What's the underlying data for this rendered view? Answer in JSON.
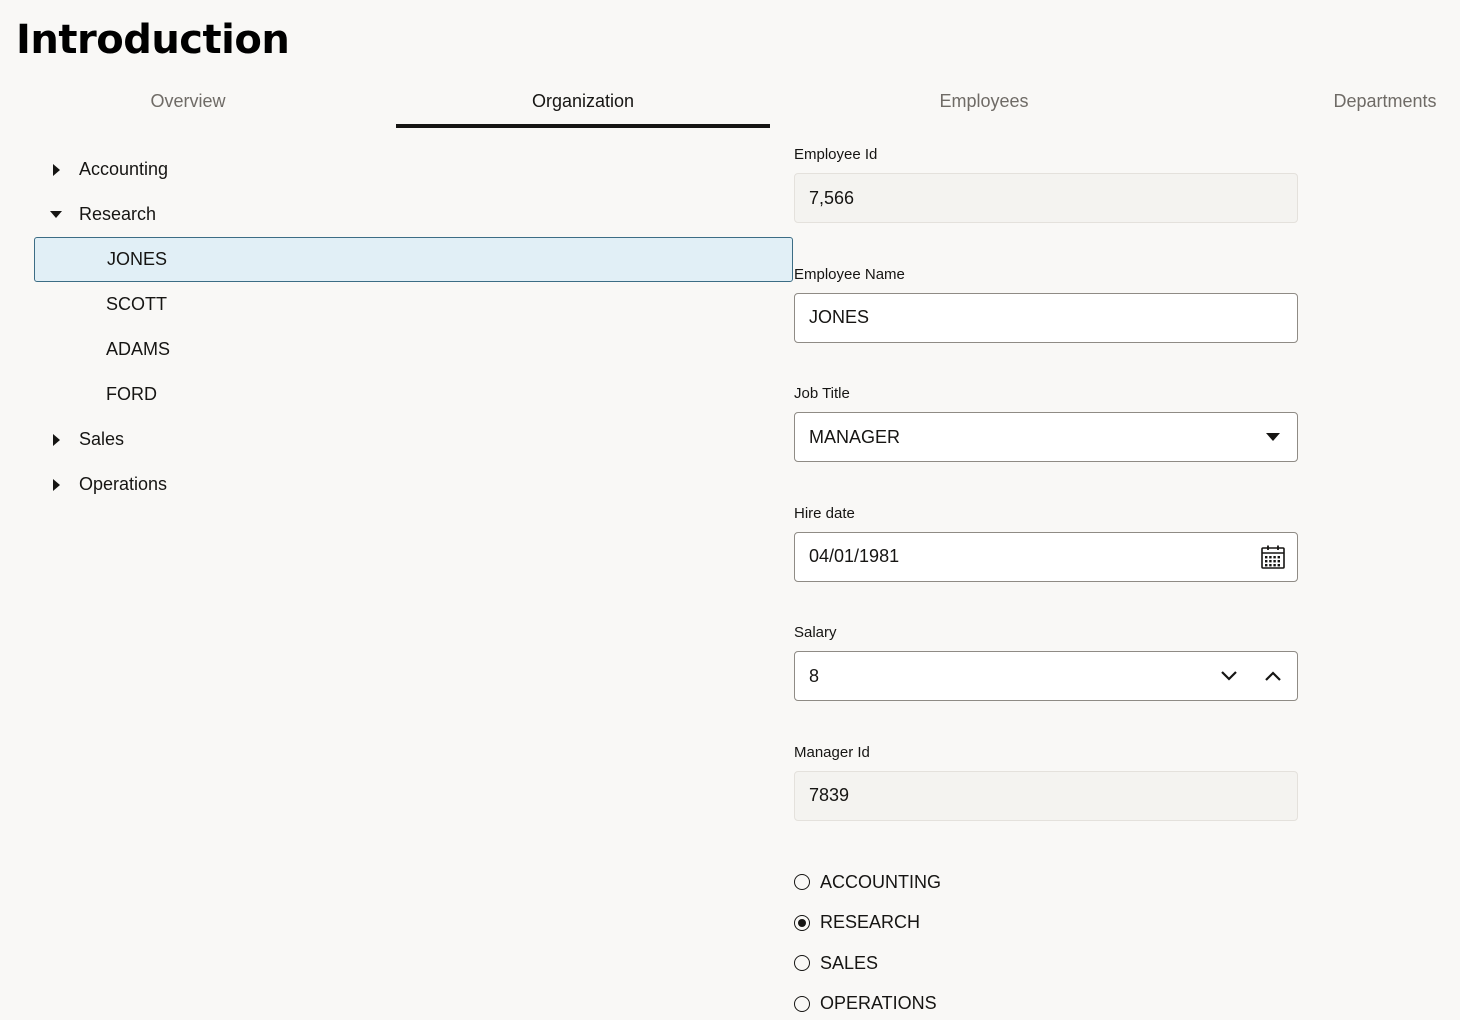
{
  "page": {
    "title": "Introduction"
  },
  "tabs": [
    {
      "label": "Overview",
      "selected": false
    },
    {
      "label": "Organization",
      "selected": true
    },
    {
      "label": "Employees",
      "selected": false
    },
    {
      "label": "Departments",
      "selected": false
    }
  ],
  "tree": {
    "departments": [
      {
        "label": "Accounting",
        "expanded": false
      },
      {
        "label": "Research",
        "expanded": true,
        "employees": [
          "JONES",
          "SCOTT",
          "ADAMS",
          "FORD"
        ],
        "selected_employee": "JONES"
      },
      {
        "label": "Sales",
        "expanded": false
      },
      {
        "label": "Operations",
        "expanded": false
      }
    ]
  },
  "form": {
    "employee_id": {
      "label": "Employee Id",
      "value": "7,566"
    },
    "employee_name": {
      "label": "Employee Name",
      "value": "JONES"
    },
    "job_title": {
      "label": "Job Title",
      "value": "MANAGER"
    },
    "hire_date": {
      "label": "Hire date",
      "value": "04/01/1981"
    },
    "salary": {
      "label": "Salary",
      "value": "8"
    },
    "manager_id": {
      "label": "Manager Id",
      "value": "7839"
    }
  },
  "department_radios": {
    "options": [
      "ACCOUNTING",
      "RESEARCH",
      "SALES",
      "OPERATIONS"
    ],
    "selected": "RESEARCH"
  },
  "icons": {
    "collapsed": "caret-right-icon",
    "expanded": "caret-down-icon",
    "dropdown": "caret-down-icon",
    "calendar": "calendar-icon",
    "decrement": "chevron-down-icon",
    "increment": "chevron-up-icon"
  }
}
